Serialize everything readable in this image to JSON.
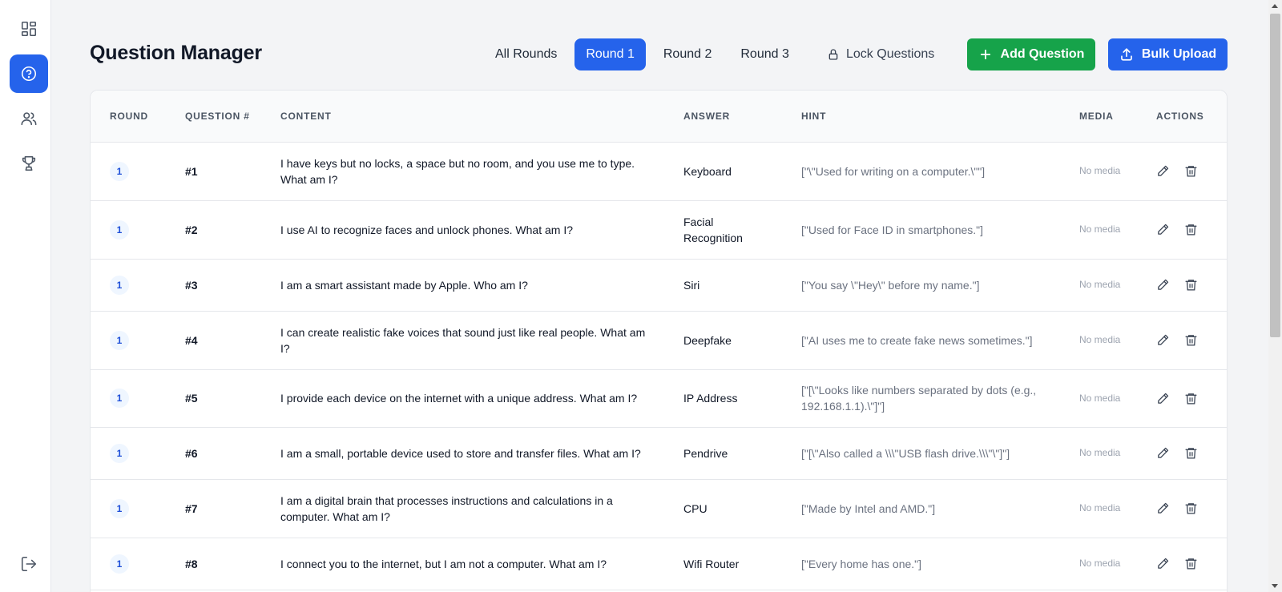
{
  "page": {
    "title": "Question Manager"
  },
  "sidebar": {
    "items": [
      {
        "name": "dashboard",
        "icon": "dashboard-icon"
      },
      {
        "name": "questions",
        "icon": "help-circle-icon",
        "active": true
      },
      {
        "name": "users",
        "icon": "users-icon"
      },
      {
        "name": "leaderboard",
        "icon": "trophy-icon"
      }
    ],
    "logout_icon": "logout-icon"
  },
  "tabs": [
    {
      "label": "All Rounds"
    },
    {
      "label": "Round 1",
      "active": true
    },
    {
      "label": "Round 2"
    },
    {
      "label": "Round 3"
    }
  ],
  "toolbar": {
    "lock_label": "Lock Questions",
    "add_label": "Add Question",
    "upload_label": "Bulk Upload"
  },
  "colors": {
    "primary": "#2563eb",
    "success": "#16a34a",
    "background": "#f3f4f6"
  },
  "table": {
    "headers": {
      "round": "Round",
      "question_num": "Question #",
      "content": "Content",
      "answer": "Answer",
      "hint": "Hint",
      "media": "Media",
      "actions": "Actions"
    },
    "rows": [
      {
        "round": "1",
        "num": "#1",
        "content": "I have keys but no locks, a space but no room, and you use me to type. What am I?",
        "answer": "Keyboard",
        "hint": "[\"\\\"Used for writing on a computer.\\\"\"]",
        "media": "No media"
      },
      {
        "round": "1",
        "num": "#2",
        "content": "I use AI to recognize faces and unlock phones. What am I?",
        "answer": "Facial Recognition",
        "hint": "[\"Used for Face ID in smartphones.\"]",
        "media": "No media"
      },
      {
        "round": "1",
        "num": "#3",
        "content": "I am a smart assistant made by Apple. Who am I?",
        "answer": "Siri",
        "hint": "[\"You say \\\"Hey\\\" before my name.\"]",
        "media": "No media"
      },
      {
        "round": "1",
        "num": "#4",
        "content": "I can create realistic fake voices that sound just like real people. What am I?",
        "answer": "Deepfake",
        "hint": "[\"AI uses me to create fake news sometimes.\"]",
        "media": "No media"
      },
      {
        "round": "1",
        "num": "#5",
        "content": "I provide each device on the internet with a unique address. What am I?",
        "answer": "IP Address",
        "hint": "[\"[\\\"Looks like numbers separated by dots (e.g., 192.168.1.1).\\\"]\"]",
        "media": "No media"
      },
      {
        "round": "1",
        "num": "#6",
        "content": "I am a small, portable device used to store and transfer files. What am I?",
        "answer": "Pendrive",
        "hint": "[\"[\\\"Also called a \\\\\\\"USB flash drive.\\\\\\\"\\\"]\"]",
        "media": "No media"
      },
      {
        "round": "1",
        "num": "#7",
        "content": "I am a digital brain that processes instructions and calculations in a computer. What am I?",
        "answer": "CPU",
        "hint": "[\"Made by Intel and AMD.\"]",
        "media": "No media"
      },
      {
        "round": "1",
        "num": "#8",
        "content": "I connect you to the internet, but I am not a computer. What am I?",
        "answer": "Wifi Router",
        "hint": "[\"Every home has one.\"]",
        "media": "No media"
      }
    ]
  }
}
